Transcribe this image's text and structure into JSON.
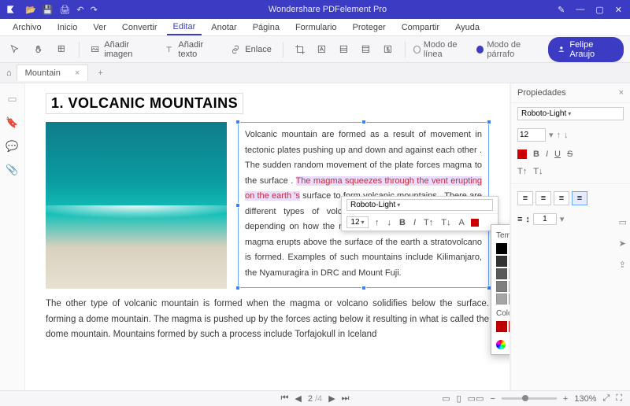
{
  "titlebar": {
    "title": "Wondershare PDFelement Pro"
  },
  "menubar": [
    "Archivo",
    "Inicio",
    "Ver",
    "Convertir",
    "Editar",
    "Anotar",
    "Página",
    "Formulario",
    "Proteger",
    "Compartir",
    "Ayuda"
  ],
  "menubar_active": 4,
  "toolbar": {
    "addimg": "Añadir imagen",
    "addtxt": "Añadir texto",
    "link": "Enlace",
    "mode_line": "Modo de línea",
    "mode_para": "Modo de párrafo"
  },
  "user": {
    "name": "Felipe Araujo"
  },
  "tab": {
    "name": "Mountain"
  },
  "doc": {
    "heading": "1. VOLCANIC MOUNTAINS",
    "p_before": "Volcanic mountain are formed as a result of movement in tectonic plates pushing up and down and against each other . The sudden random movement  of the plate forces magma to the surface . ",
    "p_hl": "The magma squeezes through the vent erupting on the earth 's",
    "p_after": " surface to form volcanic mountains . There are different types of volcanic mountains that are formed depending  on how the magma erupts . For instance, if the magma erupts above the surface of the earth a stratovolcano is formed. Examples of such mountains include Kilimanjaro, the Nyamuragira in DRC and Mount Fuji.",
    "p_lower": "The other type of volcanic mountain is formed when the magma or volcano solidifies below the surface. forming a dome mountain. The magma is pushed up by the forces acting below it resulting in what is called the dome mountain. Mountains formed by such a process include Torfajokull in Iceland"
  },
  "mini": {
    "font": "Roboto-Light",
    "size": "12",
    "b": "B",
    "i": "I",
    "t1": "T↑",
    "t2": "T↓",
    "a": "A"
  },
  "colorpop": {
    "themes": "Temas de colores",
    "standard": "Colores estándar",
    "more": "Más colores",
    "theme_colors": [
      "#000000",
      "#ffffff",
      "#e7e6e6",
      "#44546a",
      "#4472c4",
      "#ed7d31",
      "#a5a5a5",
      "#ffc000",
      "#5b9bd5",
      "#70ad47",
      "#333333",
      "#f2f2f2",
      "#d0cece",
      "#d6dce4",
      "#d9e2f3",
      "#fbe5d5",
      "#ededed",
      "#fff2cc",
      "#deebf7",
      "#e2efd9",
      "#595959",
      "#d8d8d8",
      "#aeabab",
      "#adb9ca",
      "#b4c6e7",
      "#f7cbac",
      "#dbdbdb",
      "#fee599",
      "#bdd7ee",
      "#c5e0b3",
      "#7f7f7f",
      "#bfbfbf",
      "#757070",
      "#8496b0",
      "#8eaadb",
      "#f4b183",
      "#c9c9c9",
      "#ffd965",
      "#9cc3e5",
      "#a8d08d",
      "#a5a5a5",
      "#a5a5a5",
      "#3a3838",
      "#323f4f",
      "#2f5496",
      "#c55a11",
      "#7b7b7b",
      "#bf9000",
      "#2e75b5",
      "#538135"
    ],
    "std_colors": [
      "#c00000",
      "#ff0000",
      "#ffc000",
      "#ffff00",
      "#92d050",
      "#00b050",
      "#00b0f0",
      "#0070c0",
      "#002060",
      "#7030a0"
    ]
  },
  "props": {
    "title": "Propiedades",
    "font": "Roboto-Light",
    "size": "12",
    "b": "B",
    "i": "I",
    "u": "U",
    "s": "S",
    "t1": "T↑",
    "t2": "T↓",
    "list_icon": "≡",
    "num1": "1"
  },
  "status": {
    "page": "2",
    "total": "/4",
    "zoom": "130%"
  }
}
